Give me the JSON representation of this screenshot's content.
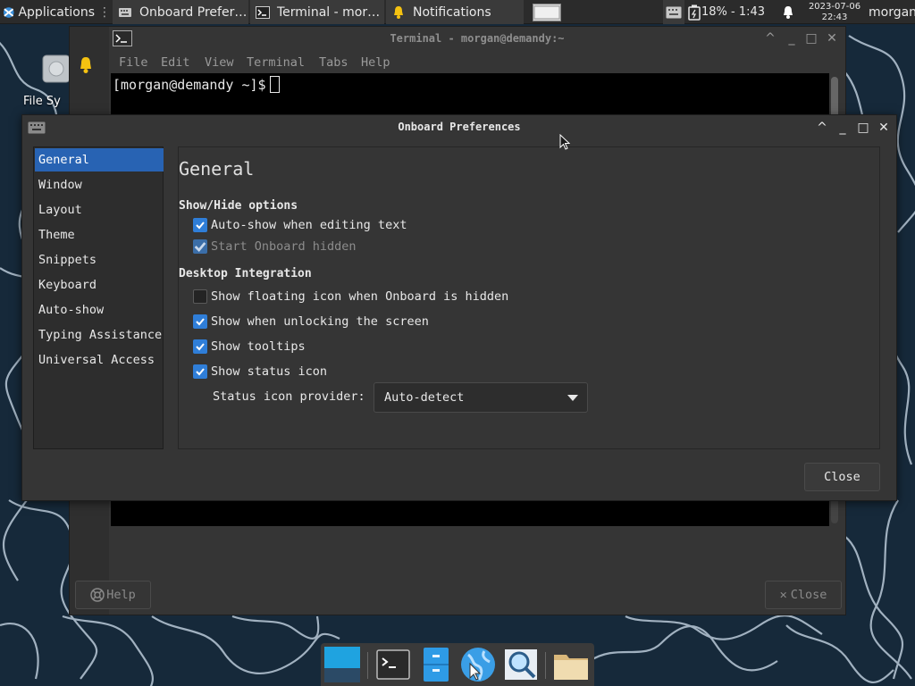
{
  "top_panel": {
    "applications_label": "Applications",
    "tasks": [
      {
        "label": "Onboard Prefer…"
      },
      {
        "label": "Terminal - mor…"
      },
      {
        "label": "Notifications"
      }
    ],
    "battery_text": "18% - 1:43",
    "clock_date": "2023-07-06",
    "clock_time": "22:43",
    "user": "morgan"
  },
  "desktop": {
    "icon_label": "File Sy"
  },
  "terminal": {
    "title": "Terminal - morgan@demandy:~",
    "menu": [
      "File",
      "Edit",
      "View",
      "Terminal",
      "Tabs",
      "Help"
    ],
    "prompt": "[morgan@demandy ~]$",
    "help_button": "Help",
    "close_button": "Close"
  },
  "preferences": {
    "title": "Onboard Preferences",
    "sidebar": [
      "General",
      "Window",
      "Layout",
      "Theme",
      "Snippets",
      "Keyboard",
      "Auto-show",
      "Typing Assistance",
      "Universal Access"
    ],
    "active_index": 0,
    "heading": "General",
    "show_hide": {
      "title": "Show/Hide options",
      "options": [
        {
          "label": "Auto-show when editing text",
          "checked": true,
          "enabled": true
        },
        {
          "label": "Start Onboard hidden",
          "checked": true,
          "enabled": false
        }
      ]
    },
    "desktop_integration": {
      "title": "Desktop Integration",
      "options": [
        {
          "label": "Show floating icon when Onboard is hidden",
          "checked": false,
          "enabled": true
        },
        {
          "label": "Show when unlocking the screen",
          "checked": true,
          "enabled": true
        },
        {
          "label": "Show tooltips",
          "checked": true,
          "enabled": true
        },
        {
          "label": "Show status icon",
          "checked": true,
          "enabled": true
        }
      ]
    },
    "status_provider_label": "Status icon provider:",
    "status_provider_value": "Auto-detect",
    "close_button": "Close"
  },
  "colors": {
    "accent": "#2863b3",
    "checkbox": "#2f7ed8",
    "window_bg": "#353535",
    "panel_bg": "#2b2b2b"
  },
  "icons": [
    "xfce-logo-icon",
    "keyboard-icon",
    "terminal-icon",
    "bell-icon",
    "window-icon",
    "battery-icon",
    "drive-icon",
    "help-icon",
    "close-icon",
    "chevron-down-icon",
    "mouse-pointer-icon",
    "workspace-icon",
    "file-manager-icon",
    "web-browser-icon",
    "search-icon",
    "folder-icon"
  ]
}
